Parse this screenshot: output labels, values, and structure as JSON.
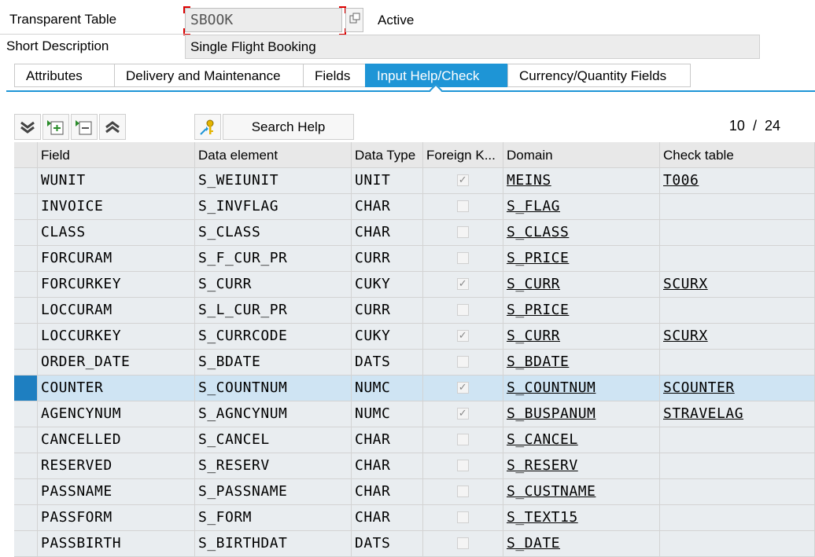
{
  "header": {
    "table_label": "Transparent Table",
    "table_name": "SBOOK",
    "status": "Active",
    "short_desc_label": "Short Description",
    "short_desc_value": "Single Flight Booking"
  },
  "tabs": [
    {
      "label": "Attributes",
      "active": false
    },
    {
      "label": "Delivery and Maintenance",
      "active": false
    },
    {
      "label": "Fields",
      "active": false
    },
    {
      "label": "Input Help/Check",
      "active": true
    },
    {
      "label": "Currency/Quantity Fields",
      "active": false
    }
  ],
  "toolbar": {
    "icons": [
      "expand-all-icon",
      "insert-row-icon",
      "delete-row-icon",
      "collapse-all-icon",
      "generate-check-table-icon"
    ],
    "search_help_label": "Search Help"
  },
  "pager": {
    "current": "10",
    "separator": "/",
    "total": "24"
  },
  "grid": {
    "columns": [
      "Field",
      "Data element",
      "Data Type",
      "Foreign K...",
      "Domain",
      "Check table"
    ],
    "rows": [
      {
        "field": "WUNIT",
        "data_element": "S_WEIUNIT",
        "data_type": "UNIT",
        "foreign_key": true,
        "domain": "MEINS",
        "check_table": "T006"
      },
      {
        "field": "INVOICE",
        "data_element": "S_INVFLAG",
        "data_type": "CHAR",
        "foreign_key": false,
        "domain": "S_FLAG",
        "check_table": ""
      },
      {
        "field": "CLASS",
        "data_element": "S_CLASS",
        "data_type": "CHAR",
        "foreign_key": false,
        "domain": "S_CLASS",
        "check_table": ""
      },
      {
        "field": "FORCURAM",
        "data_element": "S_F_CUR_PR",
        "data_type": "CURR",
        "foreign_key": false,
        "domain": "S_PRICE",
        "check_table": ""
      },
      {
        "field": "FORCURKEY",
        "data_element": "S_CURR",
        "data_type": "CUKY",
        "foreign_key": true,
        "domain": "S_CURR",
        "check_table": "SCURX"
      },
      {
        "field": "LOCCURAM",
        "data_element": "S_L_CUR_PR",
        "data_type": "CURR",
        "foreign_key": false,
        "domain": "S_PRICE",
        "check_table": ""
      },
      {
        "field": "LOCCURKEY",
        "data_element": "S_CURRCODE",
        "data_type": "CUKY",
        "foreign_key": true,
        "domain": "S_CURR",
        "check_table": "SCURX"
      },
      {
        "field": "ORDER_DATE",
        "data_element": "S_BDATE",
        "data_type": "DATS",
        "foreign_key": false,
        "domain": "S_BDATE",
        "check_table": ""
      },
      {
        "field": "COUNTER",
        "data_element": "S_COUNTNUM",
        "data_type": "NUMC",
        "foreign_key": true,
        "domain": "S_COUNTNUM",
        "check_table": "SCOUNTER",
        "selected": true
      },
      {
        "field": "AGENCYNUM",
        "data_element": "S_AGNCYNUM",
        "data_type": "NUMC",
        "foreign_key": true,
        "domain": "S_BUSPANUM",
        "check_table": "STRAVELAG"
      },
      {
        "field": "CANCELLED",
        "data_element": "S_CANCEL",
        "data_type": "CHAR",
        "foreign_key": false,
        "domain": "S_CANCEL",
        "check_table": ""
      },
      {
        "field": "RESERVED",
        "data_element": "S_RESERV",
        "data_type": "CHAR",
        "foreign_key": false,
        "domain": "S_RESERV",
        "check_table": ""
      },
      {
        "field": "PASSNAME",
        "data_element": "S_PASSNAME",
        "data_type": "CHAR",
        "foreign_key": false,
        "domain": "S_CUSTNAME",
        "check_table": ""
      },
      {
        "field": "PASSFORM",
        "data_element": "S_FORM",
        "data_type": "CHAR",
        "foreign_key": false,
        "domain": "S_TEXT15",
        "check_table": ""
      },
      {
        "field": "PASSBIRTH",
        "data_element": "S_BIRTHDAT",
        "data_type": "DATS",
        "foreign_key": false,
        "domain": "S_DATE",
        "check_table": ""
      }
    ]
  },
  "colors": {
    "accent": "#1e95d6",
    "selected_row": "#cfe4f3",
    "selected_marker": "#1e7fc1"
  }
}
